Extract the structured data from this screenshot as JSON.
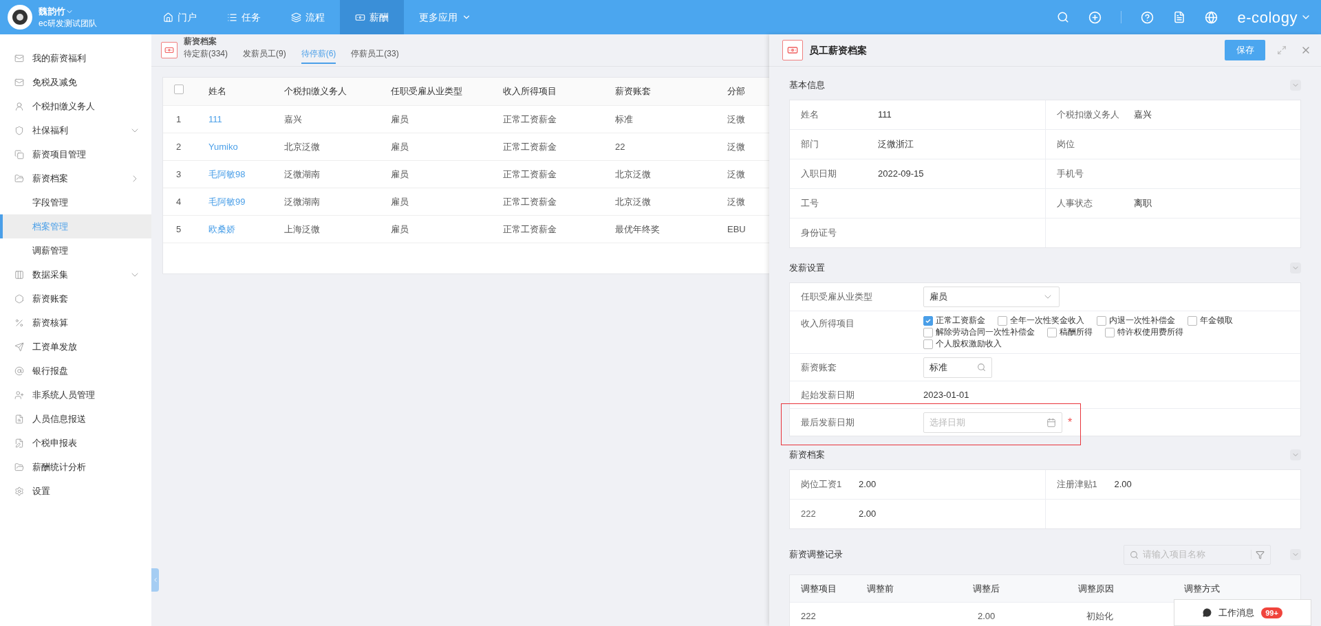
{
  "user": {
    "name": "魏韵竹",
    "team": "ec研发测试团队"
  },
  "nav": [
    {
      "label": "门户",
      "selected": false,
      "kind": "link"
    },
    {
      "label": "任务",
      "selected": false,
      "kind": "link"
    },
    {
      "label": "流程",
      "selected": false,
      "kind": "link"
    },
    {
      "label": "薪酬",
      "selected": true,
      "kind": "link"
    },
    {
      "label": "更多应用",
      "selected": false,
      "kind": "menu"
    }
  ],
  "brand": "e-cology",
  "sidebar": {
    "items": [
      {
        "label": "我的薪资福利",
        "selected": false
      },
      {
        "label": "免税及减免",
        "selected": false
      },
      {
        "label": "个税扣缴义务人",
        "selected": false
      },
      {
        "label": "社保福利",
        "selected": false,
        "expanded": false
      },
      {
        "label": "薪资项目管理",
        "selected": false
      },
      {
        "label": "薪资档案",
        "selected": false,
        "expanded": true,
        "children": [
          {
            "label": "字段管理",
            "selected": false
          },
          {
            "label": "档案管理",
            "selected": true
          },
          {
            "label": "调薪管理",
            "selected": false
          }
        ]
      },
      {
        "label": "数据采集",
        "selected": false,
        "expanded": false
      },
      {
        "label": "薪资账套",
        "selected": false
      },
      {
        "label": "薪资核算",
        "selected": false
      },
      {
        "label": "工资单发放",
        "selected": false
      },
      {
        "label": "银行报盘",
        "selected": false
      },
      {
        "label": "非系统人员管理",
        "selected": false
      },
      {
        "label": "人员信息报送",
        "selected": false
      },
      {
        "label": "个税申报表",
        "selected": false
      },
      {
        "label": "薪酬统计分析",
        "selected": false
      },
      {
        "label": "设置",
        "selected": false
      }
    ]
  },
  "module": {
    "title": "薪资档案",
    "tabs": [
      {
        "label": "待定薪(334)",
        "selected": false
      },
      {
        "label": "发薪员工(9)",
        "selected": false
      },
      {
        "label": "待停薪(6)",
        "selected": true
      },
      {
        "label": "停薪员工(33)",
        "selected": false
      }
    ]
  },
  "table": {
    "all_checked": false,
    "columns": [
      "姓名",
      "个税扣缴义务人",
      "任职受雇从业类型",
      "收入所得项目",
      "薪资账套",
      "分部"
    ],
    "rows": [
      {
        "index": "1",
        "checked": false,
        "cells": [
          "111",
          "嘉兴",
          "雇员",
          "正常工资薪金",
          "标准",
          "泛微"
        ]
      },
      {
        "index": "2",
        "checked": false,
        "cells": [
          "Yumiko",
          "北京泛微",
          "雇员",
          "正常工资薪金",
          "22",
          "泛微"
        ]
      },
      {
        "index": "3",
        "checked": false,
        "cells": [
          "毛阿敏98",
          "泛微湖南",
          "雇员",
          "正常工资薪金",
          "北京泛微",
          "泛微"
        ]
      },
      {
        "index": "4",
        "checked": false,
        "cells": [
          "毛阿敏99",
          "泛微湖南",
          "雇员",
          "正常工资薪金",
          "北京泛微",
          "泛微"
        ]
      },
      {
        "index": "5",
        "checked": false,
        "cells": [
          "欧桑娇",
          "上海泛微",
          "雇员",
          "正常工资薪金",
          "最优年终奖",
          "EBU"
        ]
      }
    ]
  },
  "drawer": {
    "title": "员工薪资档案",
    "save": "保存",
    "basic": {
      "title": "基本信息",
      "rows": [
        [
          {
            "label": "姓名",
            "value": "111"
          },
          {
            "label": "个税扣缴义务人",
            "value": "嘉兴"
          }
        ],
        [
          {
            "label": "部门",
            "value": "泛微浙江"
          },
          {
            "label": "岗位"
          }
        ],
        [
          {
            "label": "入职日期",
            "value": "2022-09-15"
          },
          {
            "label": "手机号"
          }
        ],
        [
          {
            "label": "工号"
          },
          {
            "label": "人事状态",
            "value": "离职"
          }
        ],
        [
          {
            "label": "身份证号"
          }
        ]
      ]
    },
    "payroll": {
      "title": "发薪设置",
      "rows": [
        {
          "kind": "select",
          "label": "任职受雇从业类型",
          "value": "雇员"
        },
        {
          "kind": "checks",
          "label": "收入所得项目",
          "options": [
            {
              "label": "正常工资薪金",
              "checked": true
            },
            {
              "label": "全年一次性奖金收入",
              "checked": false
            },
            {
              "label": "内退一次性补偿金",
              "checked": false
            },
            {
              "label": "年金领取",
              "checked": false
            },
            {
              "label": "解除劳动合同一次性补偿金",
              "checked": false
            },
            {
              "label": "稿酬所得",
              "checked": false
            },
            {
              "label": "特许权使用费所得",
              "checked": false
            },
            {
              "label": "个人股权激励收入",
              "checked": false
            }
          ]
        },
        {
          "kind": "search",
          "label": "薪资账套",
          "value": "标准"
        },
        {
          "kind": "text",
          "label": "起始发薪日期",
          "value": "2023-01-01"
        },
        {
          "kind": "date",
          "label": "最后发薪日期",
          "placeholder": "选择日期",
          "required_mark": "*",
          "highlighted": true
        }
      ]
    },
    "salary": {
      "title": "薪资档案",
      "rows": [
        [
          {
            "label": "岗位工资1",
            "value": "2.00"
          },
          {
            "label": "注册津贴1",
            "value": "2.00"
          }
        ],
        [
          {
            "label": "222",
            "value": "2.00"
          }
        ]
      ]
    },
    "adjust": {
      "title": "薪资调整记录",
      "search_placeholder": "请输入项目名称",
      "columns": [
        "调整项目",
        "调整前",
        "调整后",
        "调整原因",
        "调整方式"
      ],
      "rows": [
        [
          "222",
          "",
          "2.00",
          "初始化"
        ]
      ]
    }
  },
  "messages": {
    "label": "工作消息",
    "count": "99+"
  }
}
